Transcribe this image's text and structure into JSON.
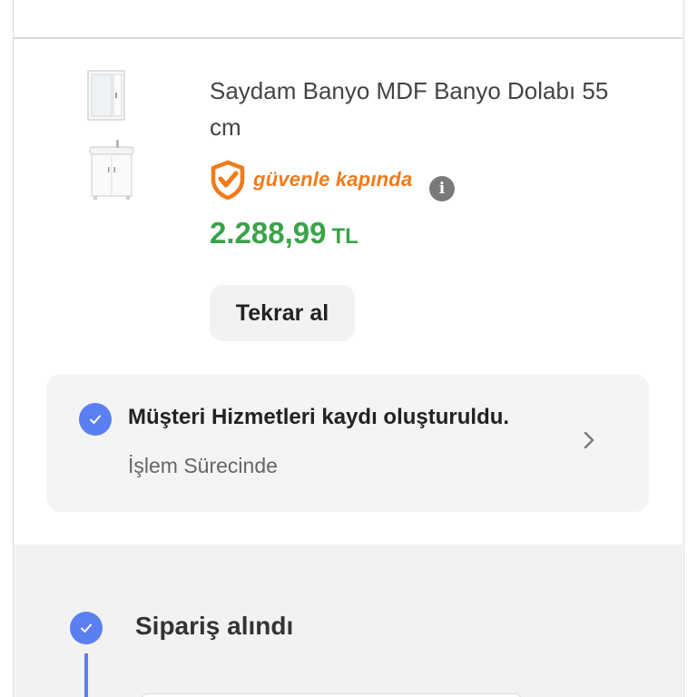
{
  "product": {
    "title": "Saydam Banyo MDF Banyo Dolabı 55 cm",
    "badge_text": "güvenle kapında",
    "info_icon": "i",
    "price_amount": "2.288,99",
    "price_currency": "TL",
    "reorder_label": "Tekrar al"
  },
  "customer_service": {
    "title": "Müşteri Hizmetleri kaydı oluşturuldu.",
    "status": "İşlem Sürecinde"
  },
  "tracking": {
    "steps": [
      {
        "label": "Sipariş alındı"
      }
    ]
  },
  "colors": {
    "price_green": "#3ba34a",
    "brand_orange": "#f27a1a",
    "check_blue": "#5b7ff0"
  }
}
